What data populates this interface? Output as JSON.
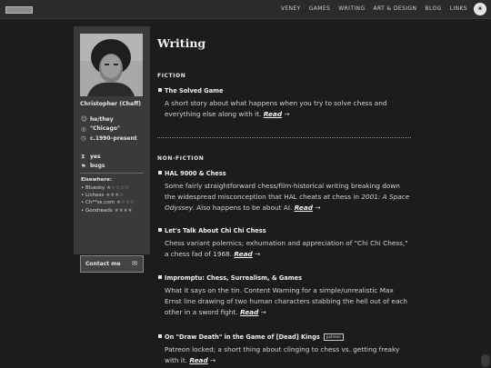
{
  "nav": {
    "items": [
      "VENEY",
      "GAMES",
      "WRITING",
      "ART & DESIGN",
      "BLOG",
      "LINKS"
    ],
    "theme_icon": "brightness-icon"
  },
  "sidebar": {
    "name": "Christopher (Chaff)",
    "facts": [
      {
        "icon": "pronoun-icon",
        "glyph": "☺",
        "text": "he/they"
      },
      {
        "icon": "globe-icon",
        "glyph": "◎",
        "text": "\"Chicago\""
      },
      {
        "icon": "clock-icon",
        "glyph": "◷",
        "text": "c.1990–present"
      }
    ],
    "facts2": [
      {
        "icon": "hourglass-icon",
        "glyph": "⧗",
        "text": "yes"
      },
      {
        "icon": "flag-icon",
        "glyph": "⚑",
        "text": "bugs"
      }
    ],
    "elsewhere_heading": "Elsewhere:",
    "elsewhere": [
      {
        "label": "• Bluesky",
        "stars": "★☆☆☆☆"
      },
      {
        "label": "• Lichess",
        "stars": "★★★☆"
      },
      {
        "label": "• Ch**ss.com",
        "stars": "★☆☆☆"
      },
      {
        "label": "• Goodreads",
        "stars": "★★★★"
      }
    ],
    "contact_label": "Contact me",
    "contact_icon": "mail-icon"
  },
  "main": {
    "title": "Writing",
    "fiction_heading": "FICTION",
    "nonfiction_heading": "NON-FICTION",
    "fiction": [
      {
        "title": "The Solved Game",
        "desc": "A short story about what happens when you try to solve chess and everything else along with it.",
        "read": "Read"
      }
    ],
    "nonfiction": [
      {
        "title": "HAL 9000 & Chess",
        "desc_a": "Some fairly straightforward chess/film-historical writing breaking down the widespread misconception that HAL cheats at chess in ",
        "desc_em": "2001: A Space Odyssey.",
        "desc_b": " Also happens to be about AI.",
        "read": "Read"
      },
      {
        "title": "Let's Talk About Chi Chi Chess",
        "desc": "Chess variant polemics; exhumation and appreciation of \"Chi Chi Chess,\" a chess fad of 1968.",
        "read": "Read"
      },
      {
        "title": "Impromptu: Chess, Surrealism, & Games",
        "desc": "What it says on the tin. Content Warning for a simple/unrealistic Max Ernst line drawing of two human characters stabbing the hell out of each other in a sword fight.",
        "read": "Read"
      },
      {
        "title": "On \"Draw Death\" in the Game of [Dead] Kings",
        "badge": "patreon",
        "desc": "Patreon locked; a short thing about clinging to chess vs. getting freaky with it.",
        "read": "Read"
      }
    ],
    "arrow": "→"
  },
  "colors": {
    "background": "#1c1c1c",
    "sidebar": "#3a3a3a",
    "topbar": "#2b2b2b",
    "text": "#d4d4d4"
  }
}
